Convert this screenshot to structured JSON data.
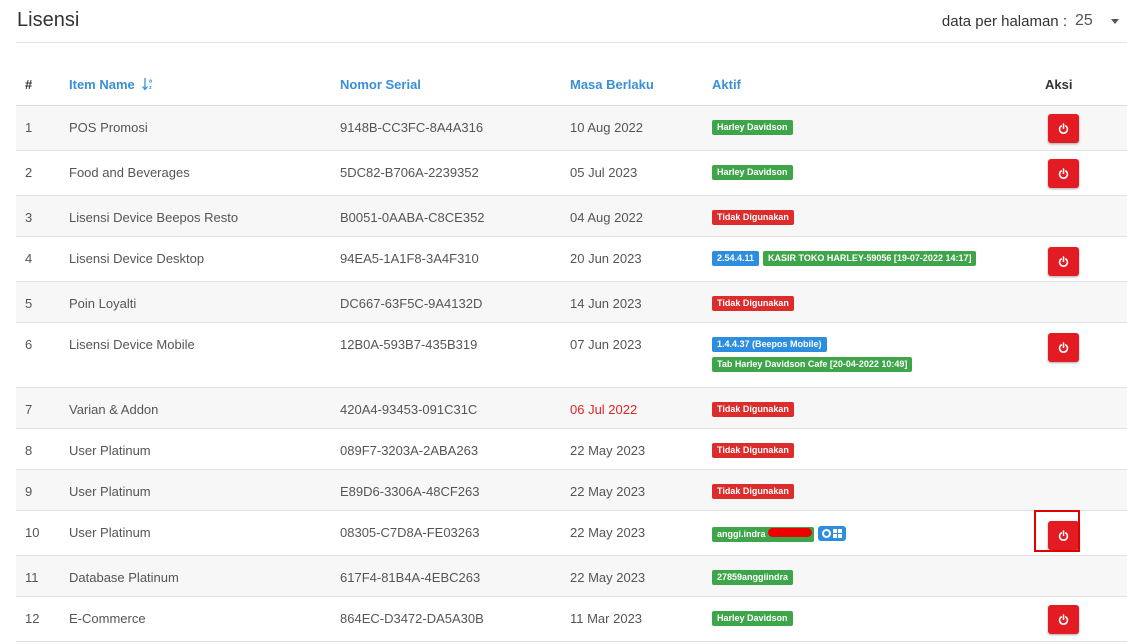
{
  "page": {
    "title": "Lisensi",
    "per_page_label": "data per halaman :",
    "per_page_value": "25"
  },
  "columns": {
    "number": "#",
    "item_name": "Item Name",
    "serial": "Nomor Serial",
    "expiry": "Masa Berlaku",
    "active": "Aktif",
    "action": "Aksi"
  },
  "colors": {
    "accent_blue": "#3a8fd6",
    "badge_green": "#3fa54a",
    "badge_red": "#dd2c2c",
    "badge_blue": "#2d8ee0",
    "action_red": "#e31b23",
    "expired_red": "#e02424"
  },
  "icons": {
    "sort": "sort-alpha-icon",
    "action": "power-icon",
    "per_page": "caret-down-icon",
    "platform": [
      "chrome-icon",
      "windows-icon"
    ]
  },
  "rows": [
    {
      "no": "1",
      "name": "POS Promosi",
      "serial": "9148B-CC3FC-8A4A316",
      "expiry": "10 Aug 2022",
      "expired": false,
      "badges": [
        [
          {
            "text": "Harley Davidson",
            "color": "green"
          }
        ]
      ],
      "action": true
    },
    {
      "no": "2",
      "name": "Food and Beverages",
      "serial": "5DC82-B706A-2239352",
      "expiry": "05 Jul 2023",
      "expired": false,
      "badges": [
        [
          {
            "text": "Harley Davidson",
            "color": "green"
          }
        ]
      ],
      "action": true
    },
    {
      "no": "3",
      "name": "Lisensi Device Beepos Resto",
      "serial": "B0051-0AABA-C8CE352",
      "expiry": "04 Aug 2022",
      "expired": false,
      "badges": [
        [
          {
            "text": "Tidak Digunakan",
            "color": "red"
          }
        ]
      ],
      "action": false
    },
    {
      "no": "4",
      "name": "Lisensi Device Desktop",
      "serial": "94EA5-1A1F8-3A4F310",
      "expiry": "20 Jun 2023",
      "expired": false,
      "badges": [
        [
          {
            "text": "2.54.4.11",
            "color": "blue"
          },
          {
            "text": "KASIR TOKO HARLEY-59056 [19-07-2022 14:17]",
            "color": "green"
          }
        ]
      ],
      "action": true
    },
    {
      "no": "5",
      "name": "Poin Loyalti",
      "serial": "DC667-63F5C-9A4132D",
      "expiry": "14 Jun 2023",
      "expired": false,
      "badges": [
        [
          {
            "text": "Tidak Digunakan",
            "color": "red"
          }
        ]
      ],
      "action": false
    },
    {
      "no": "6",
      "name": "Lisensi Device Mobile",
      "serial": "12B0A-593B7-435B319",
      "expiry": "07 Jun 2023",
      "expired": false,
      "badges": [
        [
          {
            "text": "1.4.4.37 (Beepos Mobile)",
            "color": "blue"
          }
        ],
        [
          {
            "text": "Tab Harley Davidson Cafe [20-04-2022 10:49]",
            "color": "green"
          }
        ]
      ],
      "action": true
    },
    {
      "no": "7",
      "name": "Varian & Addon",
      "serial": "420A4-93453-091C31C",
      "expiry": "06 Jul 2022",
      "expired": true,
      "badges": [
        [
          {
            "text": "Tidak Digunakan",
            "color": "red"
          }
        ]
      ],
      "action": false
    },
    {
      "no": "8",
      "name": "User Platinum",
      "serial": "089F7-3203A-2ABA263",
      "expiry": "22 May 2023",
      "expired": false,
      "badges": [
        [
          {
            "text": "Tidak Digunakan",
            "color": "red"
          }
        ]
      ],
      "action": false
    },
    {
      "no": "9",
      "name": "User Platinum",
      "serial": "E89D6-3306A-48CF263",
      "expiry": "22 May 2023",
      "expired": false,
      "badges": [
        [
          {
            "text": "Tidak Digunakan",
            "color": "red"
          }
        ]
      ],
      "action": false
    },
    {
      "no": "10",
      "name": "User Platinum",
      "serial": "08305-C7D8A-FE03263",
      "expiry": "22 May 2023",
      "expired": false,
      "badges": [
        [
          {
            "text": "anggi.indra",
            "color": "green",
            "redacted": true,
            "platform": true
          }
        ]
      ],
      "action": true,
      "highlighted": true
    },
    {
      "no": "11",
      "name": "Database Platinum",
      "serial": "617F4-81B4A-4EBC263",
      "expiry": "22 May 2023",
      "expired": false,
      "badges": [
        [
          {
            "text": "27859anggiindra",
            "color": "green"
          }
        ]
      ],
      "action": false
    },
    {
      "no": "12",
      "name": "E-Commerce",
      "serial": "864EC-D3472-DA5A30B",
      "expiry": "11 Mar 2023",
      "expired": false,
      "badges": [
        [
          {
            "text": "Harley Davidson",
            "color": "green"
          }
        ]
      ],
      "action": true
    }
  ]
}
